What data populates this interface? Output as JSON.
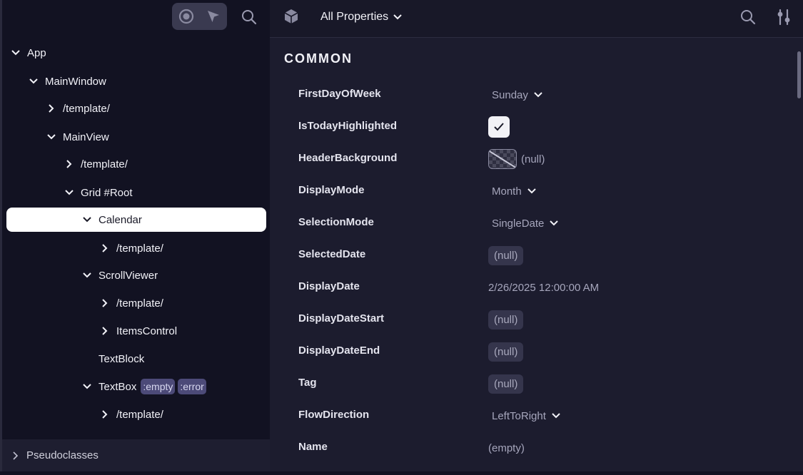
{
  "left_toolbar": {
    "tools": [
      {
        "icon": "target-icon",
        "label": ""
      },
      {
        "icon": "cursor-arrow-icon",
        "label": ""
      }
    ],
    "search_icon": "search-icon"
  },
  "tree": [
    {
      "label": "App",
      "depth": 0,
      "chevron": "down"
    },
    {
      "label": "MainWindow",
      "depth": 1,
      "chevron": "down"
    },
    {
      "label": "/template/",
      "depth": 2,
      "chevron": "right"
    },
    {
      "label": "MainView",
      "depth": 2,
      "chevron": "down"
    },
    {
      "label": "/template/",
      "depth": 3,
      "chevron": "right"
    },
    {
      "label": "Grid #Root",
      "depth": 3,
      "chevron": "down"
    },
    {
      "label": "Calendar",
      "depth": 4,
      "chevron": "down",
      "selected": true
    },
    {
      "label": "/template/",
      "depth": 5,
      "chevron": "right"
    },
    {
      "label": "ScrollViewer",
      "depth": 4,
      "chevron": "down"
    },
    {
      "label": "/template/",
      "depth": 5,
      "chevron": "right"
    },
    {
      "label": "ItemsControl",
      "depth": 5,
      "chevron": "right"
    },
    {
      "label": "TextBlock",
      "depth": 4,
      "chevron": "none"
    },
    {
      "label": "TextBox",
      "depth": 4,
      "chevron": "down",
      "pills": [
        ":empty",
        ":error"
      ]
    },
    {
      "label": "/template/",
      "depth": 5,
      "chevron": "right"
    }
  ],
  "pseudoclasses_label": "Pseudoclasses",
  "right_toolbar": {
    "filter_label": "All Properties",
    "icons": [
      "cube-icon",
      "search-icon",
      "settings-sliders-icon"
    ]
  },
  "section_title": "COMMON",
  "properties": [
    {
      "name": "FirstDayOfWeek",
      "kind": "dropdown",
      "value": "Sunday"
    },
    {
      "name": "IsTodayHighlighted",
      "kind": "checkbox",
      "checked": true
    },
    {
      "name": "HeaderBackground",
      "kind": "brush",
      "value": "(null)"
    },
    {
      "name": "DisplayMode",
      "kind": "dropdown",
      "value": "Month"
    },
    {
      "name": "SelectionMode",
      "kind": "dropdown",
      "value": "SingleDate"
    },
    {
      "name": "SelectedDate",
      "kind": "chip",
      "value": "(null)"
    },
    {
      "name": "DisplayDate",
      "kind": "text",
      "value": "2/26/2025 12:00:00 AM"
    },
    {
      "name": "DisplayDateStart",
      "kind": "chip",
      "value": "(null)"
    },
    {
      "name": "DisplayDateEnd",
      "kind": "chip",
      "value": "(null)"
    },
    {
      "name": "Tag",
      "kind": "chip",
      "value": "(null)"
    },
    {
      "name": "FlowDirection",
      "kind": "dropdown",
      "value": "LeftToRight"
    },
    {
      "name": "Name",
      "kind": "text",
      "value": "(empty)"
    }
  ],
  "colors": {
    "background": "#1c1c2e",
    "tree_background": "#121222",
    "selection": "#ffffff",
    "pill": "#4c4a78",
    "chip": "#35354c"
  }
}
